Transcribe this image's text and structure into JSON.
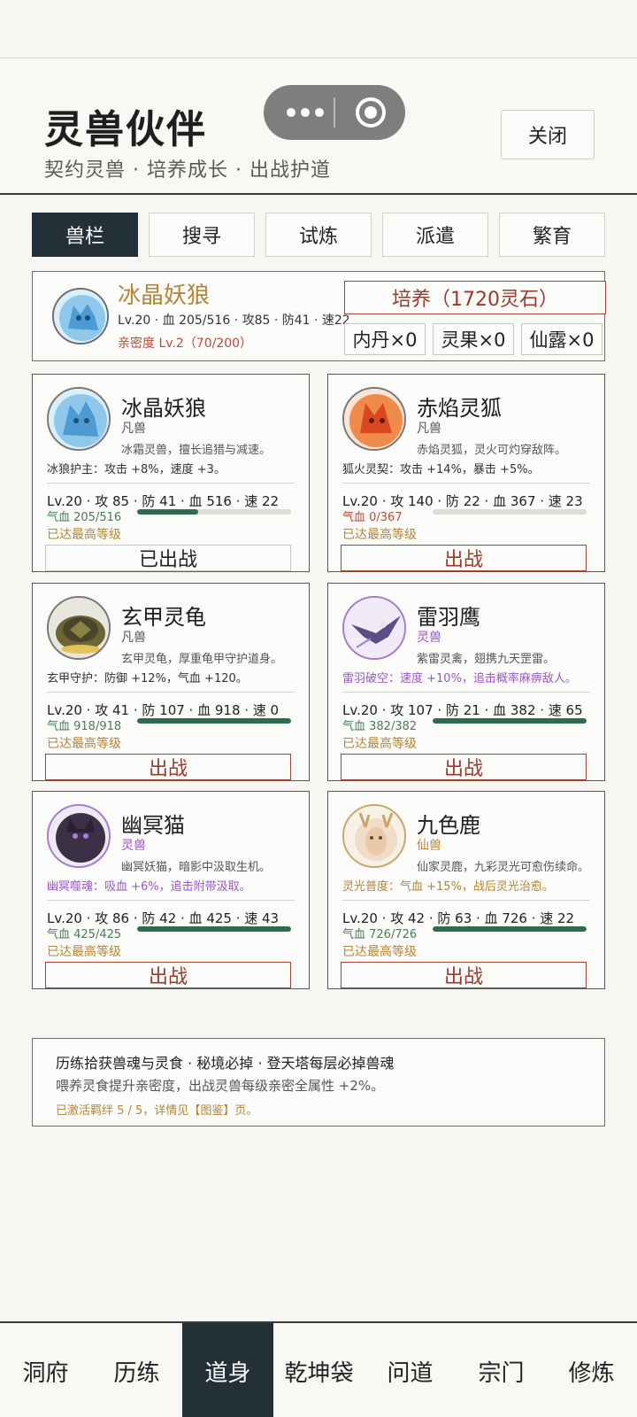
{
  "header": {
    "title": "灵兽伙伴",
    "subtitle": "契约灵兽 · 培养成长 · 出战护道",
    "close_label": "关闭"
  },
  "tabs": [
    "兽栏",
    "搜寻",
    "试炼",
    "派遣",
    "繁育"
  ],
  "active_tab": "兽栏",
  "summary": {
    "name": "冰晶妖狼",
    "stats": "Lv.20 · 血 205/516 · 攻85 · 防41 · 速22",
    "affinity": "亲密度 Lv.2（70/200）",
    "train_label": "培养（1720灵石）",
    "items": [
      "内丹×0",
      "灵果×0",
      "仙露×0"
    ]
  },
  "pets": [
    {
      "name": "冰晶妖狼",
      "rank": "凡兽",
      "desc": "冰霜灵兽，擅长追猎与减速。",
      "skill": "冰狼护主：攻击 +8%，速度 +3。",
      "stats": "Lv.20 · 攻 85 · 防 41 · 血 516 · 速 22",
      "hp": "气血 205/516",
      "hp_fraction": 0.397,
      "max_level": "已达最高等级",
      "action": "已出战",
      "colors": {
        "rank": "#555555",
        "skill": "#333333",
        "hp": "#4b7a5e",
        "avatar_border": "#777777"
      },
      "icon": "wolf-icon"
    },
    {
      "name": "赤焰灵狐",
      "rank": "凡兽",
      "desc": "赤焰灵狐，灵火可灼穿敌阵。",
      "skill": "狐火灵契：攻击 +14%，暴击 +5%。",
      "stats": "Lv.20 · 攻 140 · 防 22 · 血 367 · 速 23",
      "hp": "气血 0/367",
      "hp_fraction": 0,
      "max_level": "已达最高等级",
      "action": "出战",
      "colors": {
        "rank": "#555555",
        "skill": "#333333",
        "hp": "#b84a3a",
        "avatar_border": "#777777"
      },
      "icon": "fox-icon"
    },
    {
      "name": "玄甲灵龟",
      "rank": "凡兽",
      "desc": "玄甲灵龟，厚重龟甲守护道身。",
      "skill": "玄甲守护：防御 +12%，气血 +120。",
      "stats": "Lv.20 · 攻 41 · 防 107 · 血 918 · 速 0",
      "hp": "气血 918/918",
      "hp_fraction": 1,
      "max_level": "已达最高等级",
      "action": "出战",
      "colors": {
        "rank": "#555555",
        "skill": "#333333",
        "hp": "#4b7a5e",
        "avatar_border": "#777777"
      },
      "icon": "turtle-icon"
    },
    {
      "name": "雷羽鹰",
      "rank": "灵兽",
      "desc": "紫雷灵禽，翅携九天罡雷。",
      "skill": "雷羽破空：速度 +10%，追击概率麻痹敌人。",
      "stats": "Lv.20 · 攻 107 · 防 21 · 血 382 · 速 65",
      "hp": "气血 382/382",
      "hp_fraction": 1,
      "max_level": "已达最高等级",
      "action": "出战",
      "colors": {
        "rank": "#9a57c8",
        "skill": "#9a57c8",
        "hp": "#4b7a5e",
        "avatar_border": "#a67bd0"
      },
      "icon": "eagle-icon"
    },
    {
      "name": "幽冥猫",
      "rank": "灵兽",
      "desc": "幽冥妖猫，暗影中汲取生机。",
      "skill": "幽冥噬魂：吸血 +6%，追击附带汲取。",
      "stats": "Lv.20 · 攻 86 · 防 42 · 血 425 · 速 43",
      "hp": "气血 425/425",
      "hp_fraction": 1,
      "max_level": "已达最高等级",
      "action": "出战",
      "colors": {
        "rank": "#9a57c8",
        "skill": "#9a57c8",
        "hp": "#4b7a5e",
        "avatar_border": "#a67bd0"
      },
      "icon": "cat-icon"
    },
    {
      "name": "九色鹿",
      "rank": "仙兽",
      "desc": "仙家灵鹿，九彩灵光可愈伤续命。",
      "skill": "灵光普度：气血 +15%，战后灵光治愈。",
      "stats": "Lv.20 · 攻 42 · 防 63 · 血 726 · 速 22",
      "hp": "气血 726/726",
      "hp_fraction": 1,
      "max_level": "已达最高等级",
      "action": "出战",
      "colors": {
        "rank": "#b48536",
        "skill": "#b48536",
        "hp": "#4b7a5e",
        "avatar_border": "#c9a567"
      },
      "icon": "deer-icon"
    }
  ],
  "notice": {
    "line1": "历练拾获兽魂与灵食 · 秘境必掉 · 登天塔每层必掉兽魂",
    "line2": "喂养灵食提升亲密度，出战灵兽每级亲密全属性 +2%。",
    "line3": "已激活羁绊 5 / 5，详情见【图鉴】页。"
  },
  "bottom_nav": [
    "洞府",
    "历练",
    "道身",
    "乾坤袋",
    "问道",
    "宗门",
    "修炼"
  ],
  "active_nav": "道身"
}
